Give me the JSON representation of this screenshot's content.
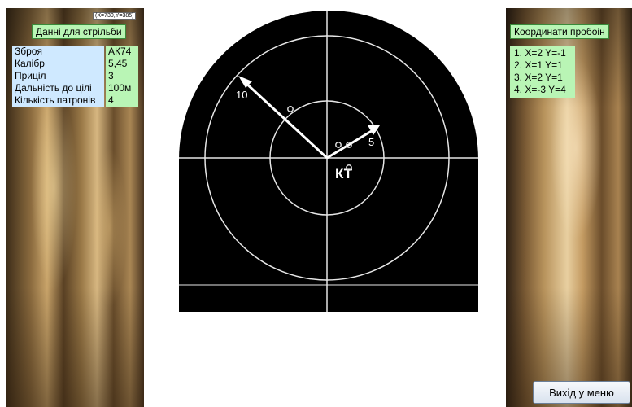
{
  "coords_readout": "(X=730,Y=385)",
  "left_panel": {
    "header": "Данні для стрільби",
    "rows": [
      {
        "label": "Зброя",
        "value": "АК74"
      },
      {
        "label": "Калібр",
        "value": "5,45"
      },
      {
        "label": "Приціл",
        "value": "3"
      },
      {
        "label": "Дальність до цілі",
        "value": "100м"
      },
      {
        "label": "Кількість патронів",
        "value": "4"
      }
    ]
  },
  "right_panel": {
    "header": "Координати пробоін",
    "holes": [
      "1. X=2  Y=-1",
      "2. X=1  Y=1",
      "3. X=2  Y=1",
      "4. X=-3  Y=4"
    ],
    "exit_label": "Вихід у меню"
  },
  "target": {
    "ring_label_outer": "10",
    "ring_label_inner": "5",
    "center_label": "КТ"
  }
}
